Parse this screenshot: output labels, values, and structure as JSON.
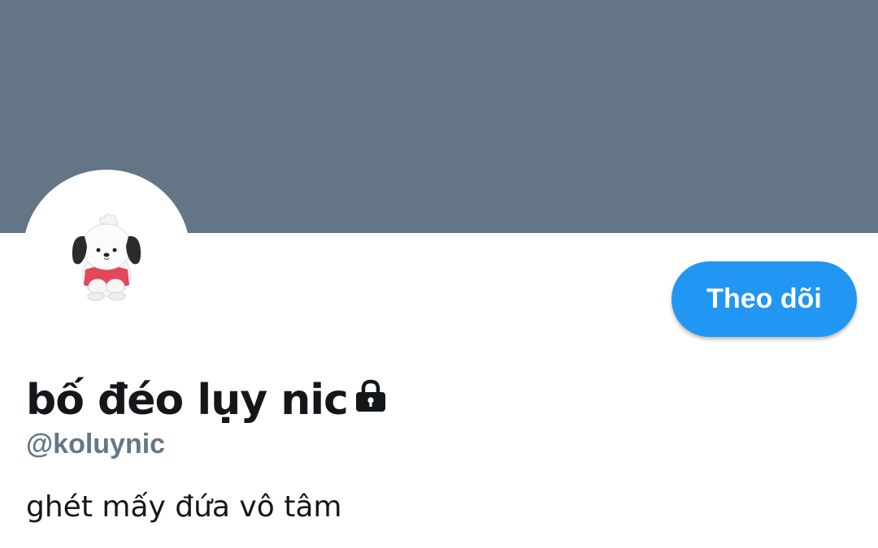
{
  "colors": {
    "banner": "#647586",
    "accent": "#2196f3",
    "handle": "#657786",
    "text": "#14171a"
  },
  "profile": {
    "avatar_icon": "pochacco-figure-avatar",
    "display_name": "bố đéo lụy nic",
    "protected_icon": "lock-icon",
    "handle": "@koluynic",
    "bio": "ghét mấy đứa vô tâm"
  },
  "actions": {
    "follow_label": "Theo dõi"
  }
}
